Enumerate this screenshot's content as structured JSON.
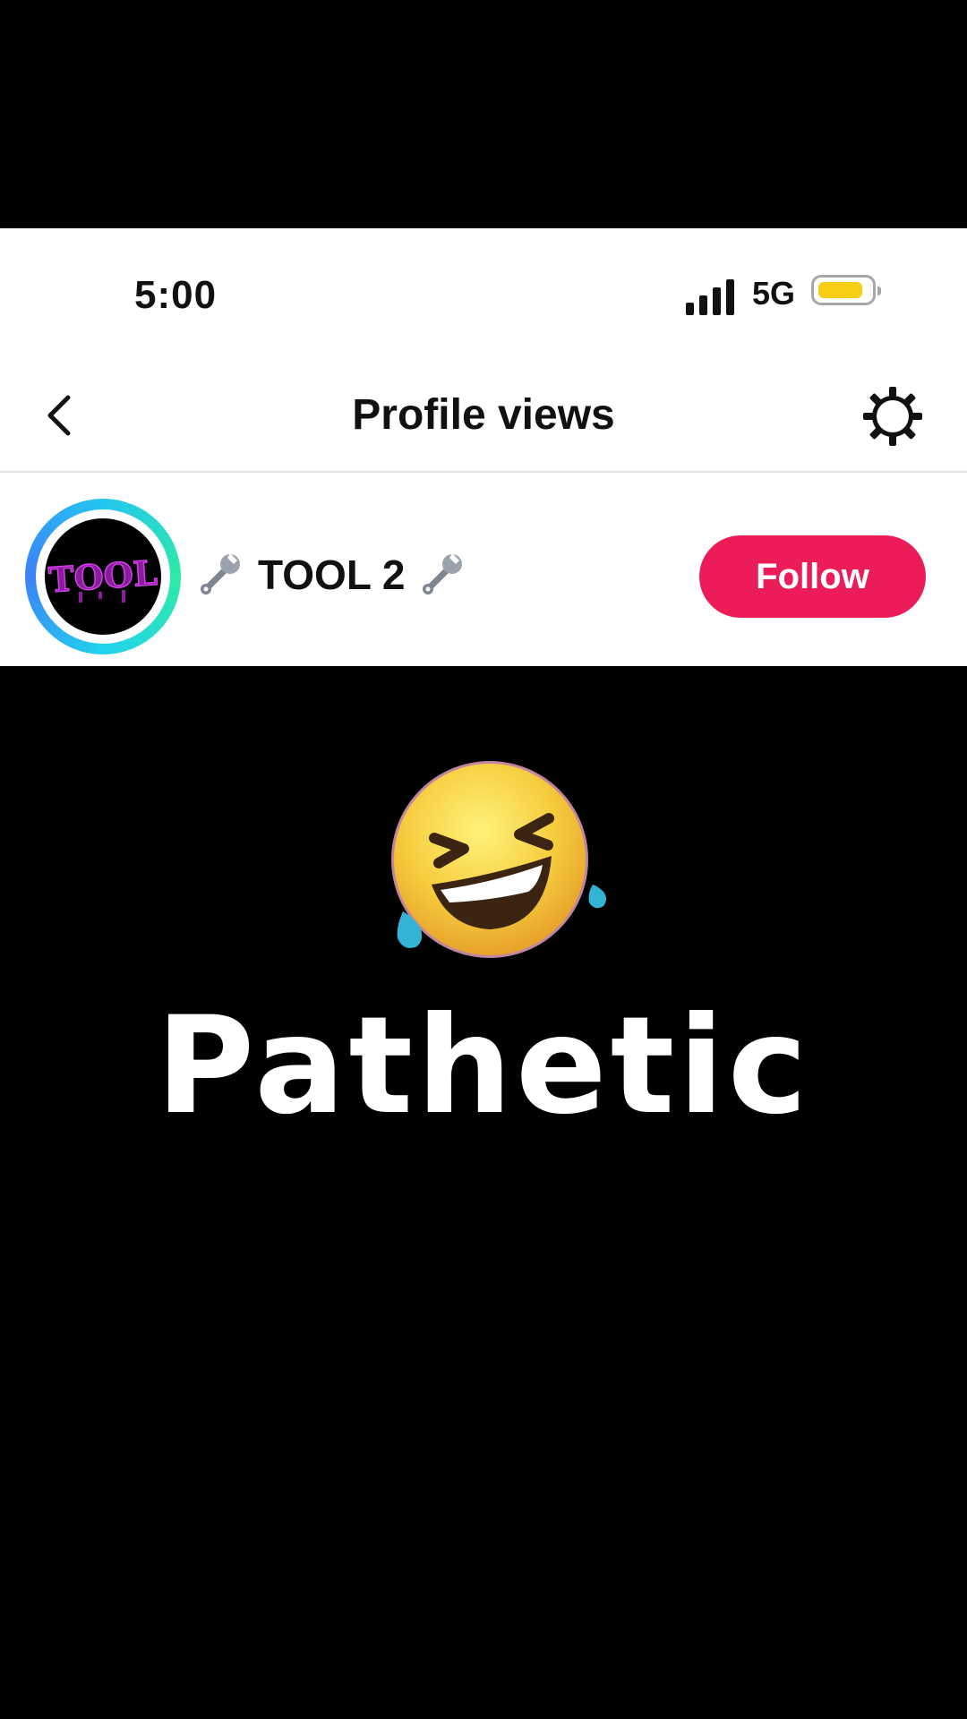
{
  "status_bar": {
    "time": "5:00",
    "network": "5G"
  },
  "header": {
    "title": "Profile views"
  },
  "profile": {
    "username": "TOOL 2",
    "follow_label": "Follow",
    "avatar_text": "TOOL"
  },
  "content": {
    "caption": "Pathetic"
  },
  "icons": {
    "back": "chevron-left-icon",
    "settings": "gear-icon",
    "wrench": "wrench-icon",
    "emoji": "laughing-emoji"
  },
  "colors": {
    "follow_button": "#eb1c58",
    "battery": "#f7cd16",
    "avatar_ring": "#25c6f2"
  }
}
